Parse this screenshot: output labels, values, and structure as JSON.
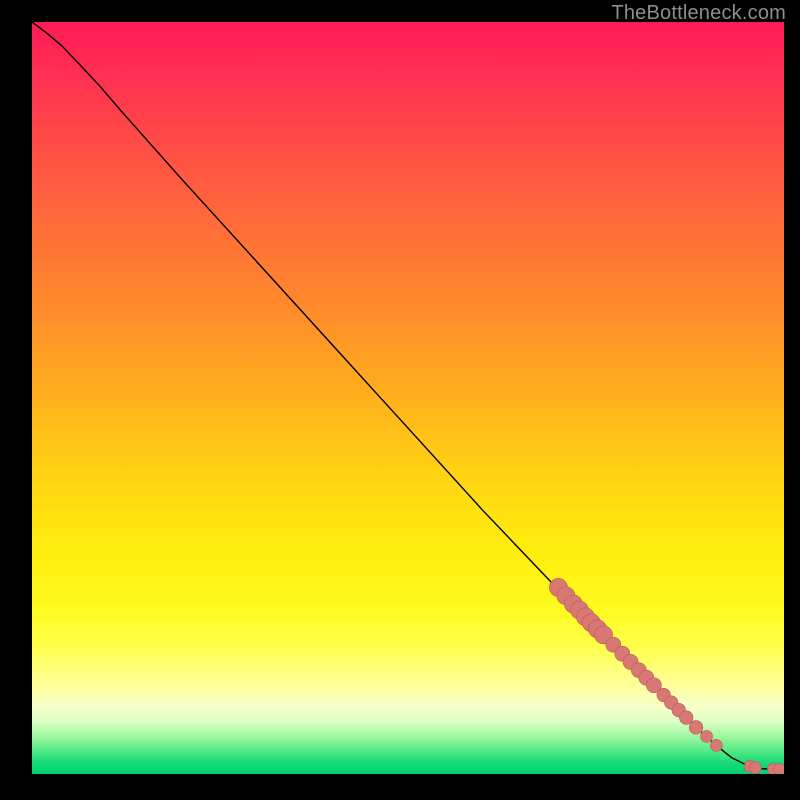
{
  "watermark": "TheBottleneck.com",
  "colors": {
    "curve": "#000000",
    "marker_fill": "#d87874",
    "marker_stroke": "#b85b56",
    "plot_bg_top": "#ff1a55",
    "plot_bg_bottom": "#00cf72",
    "page_bg": "#000000"
  },
  "chart_data": {
    "type": "line",
    "title": "",
    "xlabel": "",
    "ylabel": "",
    "xlim": [
      0,
      100
    ],
    "ylim": [
      0,
      100
    ],
    "grid": false,
    "legend": false,
    "curve_points": [
      {
        "x": 0,
        "y": 100
      },
      {
        "x": 2,
        "y": 98.5
      },
      {
        "x": 4,
        "y": 96.8
      },
      {
        "x": 6,
        "y": 94.7
      },
      {
        "x": 9,
        "y": 91.5
      },
      {
        "x": 12,
        "y": 88
      },
      {
        "x": 20,
        "y": 79
      },
      {
        "x": 30,
        "y": 68
      },
      {
        "x": 40,
        "y": 57
      },
      {
        "x": 50,
        "y": 46
      },
      {
        "x": 60,
        "y": 35
      },
      {
        "x": 70,
        "y": 24.5
      },
      {
        "x": 75,
        "y": 19.5
      },
      {
        "x": 80,
        "y": 14.5
      },
      {
        "x": 85,
        "y": 9.5
      },
      {
        "x": 88,
        "y": 6.5
      },
      {
        "x": 91,
        "y": 3.8
      },
      {
        "x": 93,
        "y": 2.2
      },
      {
        "x": 95,
        "y": 1.2
      },
      {
        "x": 97,
        "y": 0.7
      },
      {
        "x": 100,
        "y": 0.6
      }
    ],
    "markers": [
      {
        "x": 70,
        "y": 24.8,
        "r": 1.2
      },
      {
        "x": 71,
        "y": 23.7,
        "r": 1.2
      },
      {
        "x": 72,
        "y": 22.6,
        "r": 1.2
      },
      {
        "x": 72.8,
        "y": 21.8,
        "r": 1.2
      },
      {
        "x": 73.6,
        "y": 20.9,
        "r": 1.2
      },
      {
        "x": 74.4,
        "y": 20.1,
        "r": 1.2
      },
      {
        "x": 75.2,
        "y": 19.3,
        "r": 1.2
      },
      {
        "x": 76,
        "y": 18.5,
        "r": 1.2
      },
      {
        "x": 77.3,
        "y": 17.2,
        "r": 1.0
      },
      {
        "x": 78.5,
        "y": 16.0,
        "r": 1.0
      },
      {
        "x": 79.6,
        "y": 14.9,
        "r": 1.0
      },
      {
        "x": 80.7,
        "y": 13.8,
        "r": 1.0
      },
      {
        "x": 81.7,
        "y": 12.8,
        "r": 1.0
      },
      {
        "x": 82.7,
        "y": 11.8,
        "r": 1.0
      },
      {
        "x": 84,
        "y": 10.5,
        "r": 0.9
      },
      {
        "x": 85,
        "y": 9.5,
        "r": 0.9
      },
      {
        "x": 86,
        "y": 8.5,
        "r": 0.9
      },
      {
        "x": 87,
        "y": 7.5,
        "r": 0.9
      },
      {
        "x": 88.3,
        "y": 6.2,
        "r": 0.9
      },
      {
        "x": 89.7,
        "y": 5,
        "r": 0.8
      },
      {
        "x": 91,
        "y": 3.8,
        "r": 0.8
      },
      {
        "x": 95.5,
        "y": 1.0,
        "r": 0.8
      },
      {
        "x": 96.2,
        "y": 0.85,
        "r": 0.8
      },
      {
        "x": 98.6,
        "y": 0.65,
        "r": 0.8
      },
      {
        "x": 99.4,
        "y": 0.6,
        "r": 0.8
      }
    ]
  }
}
